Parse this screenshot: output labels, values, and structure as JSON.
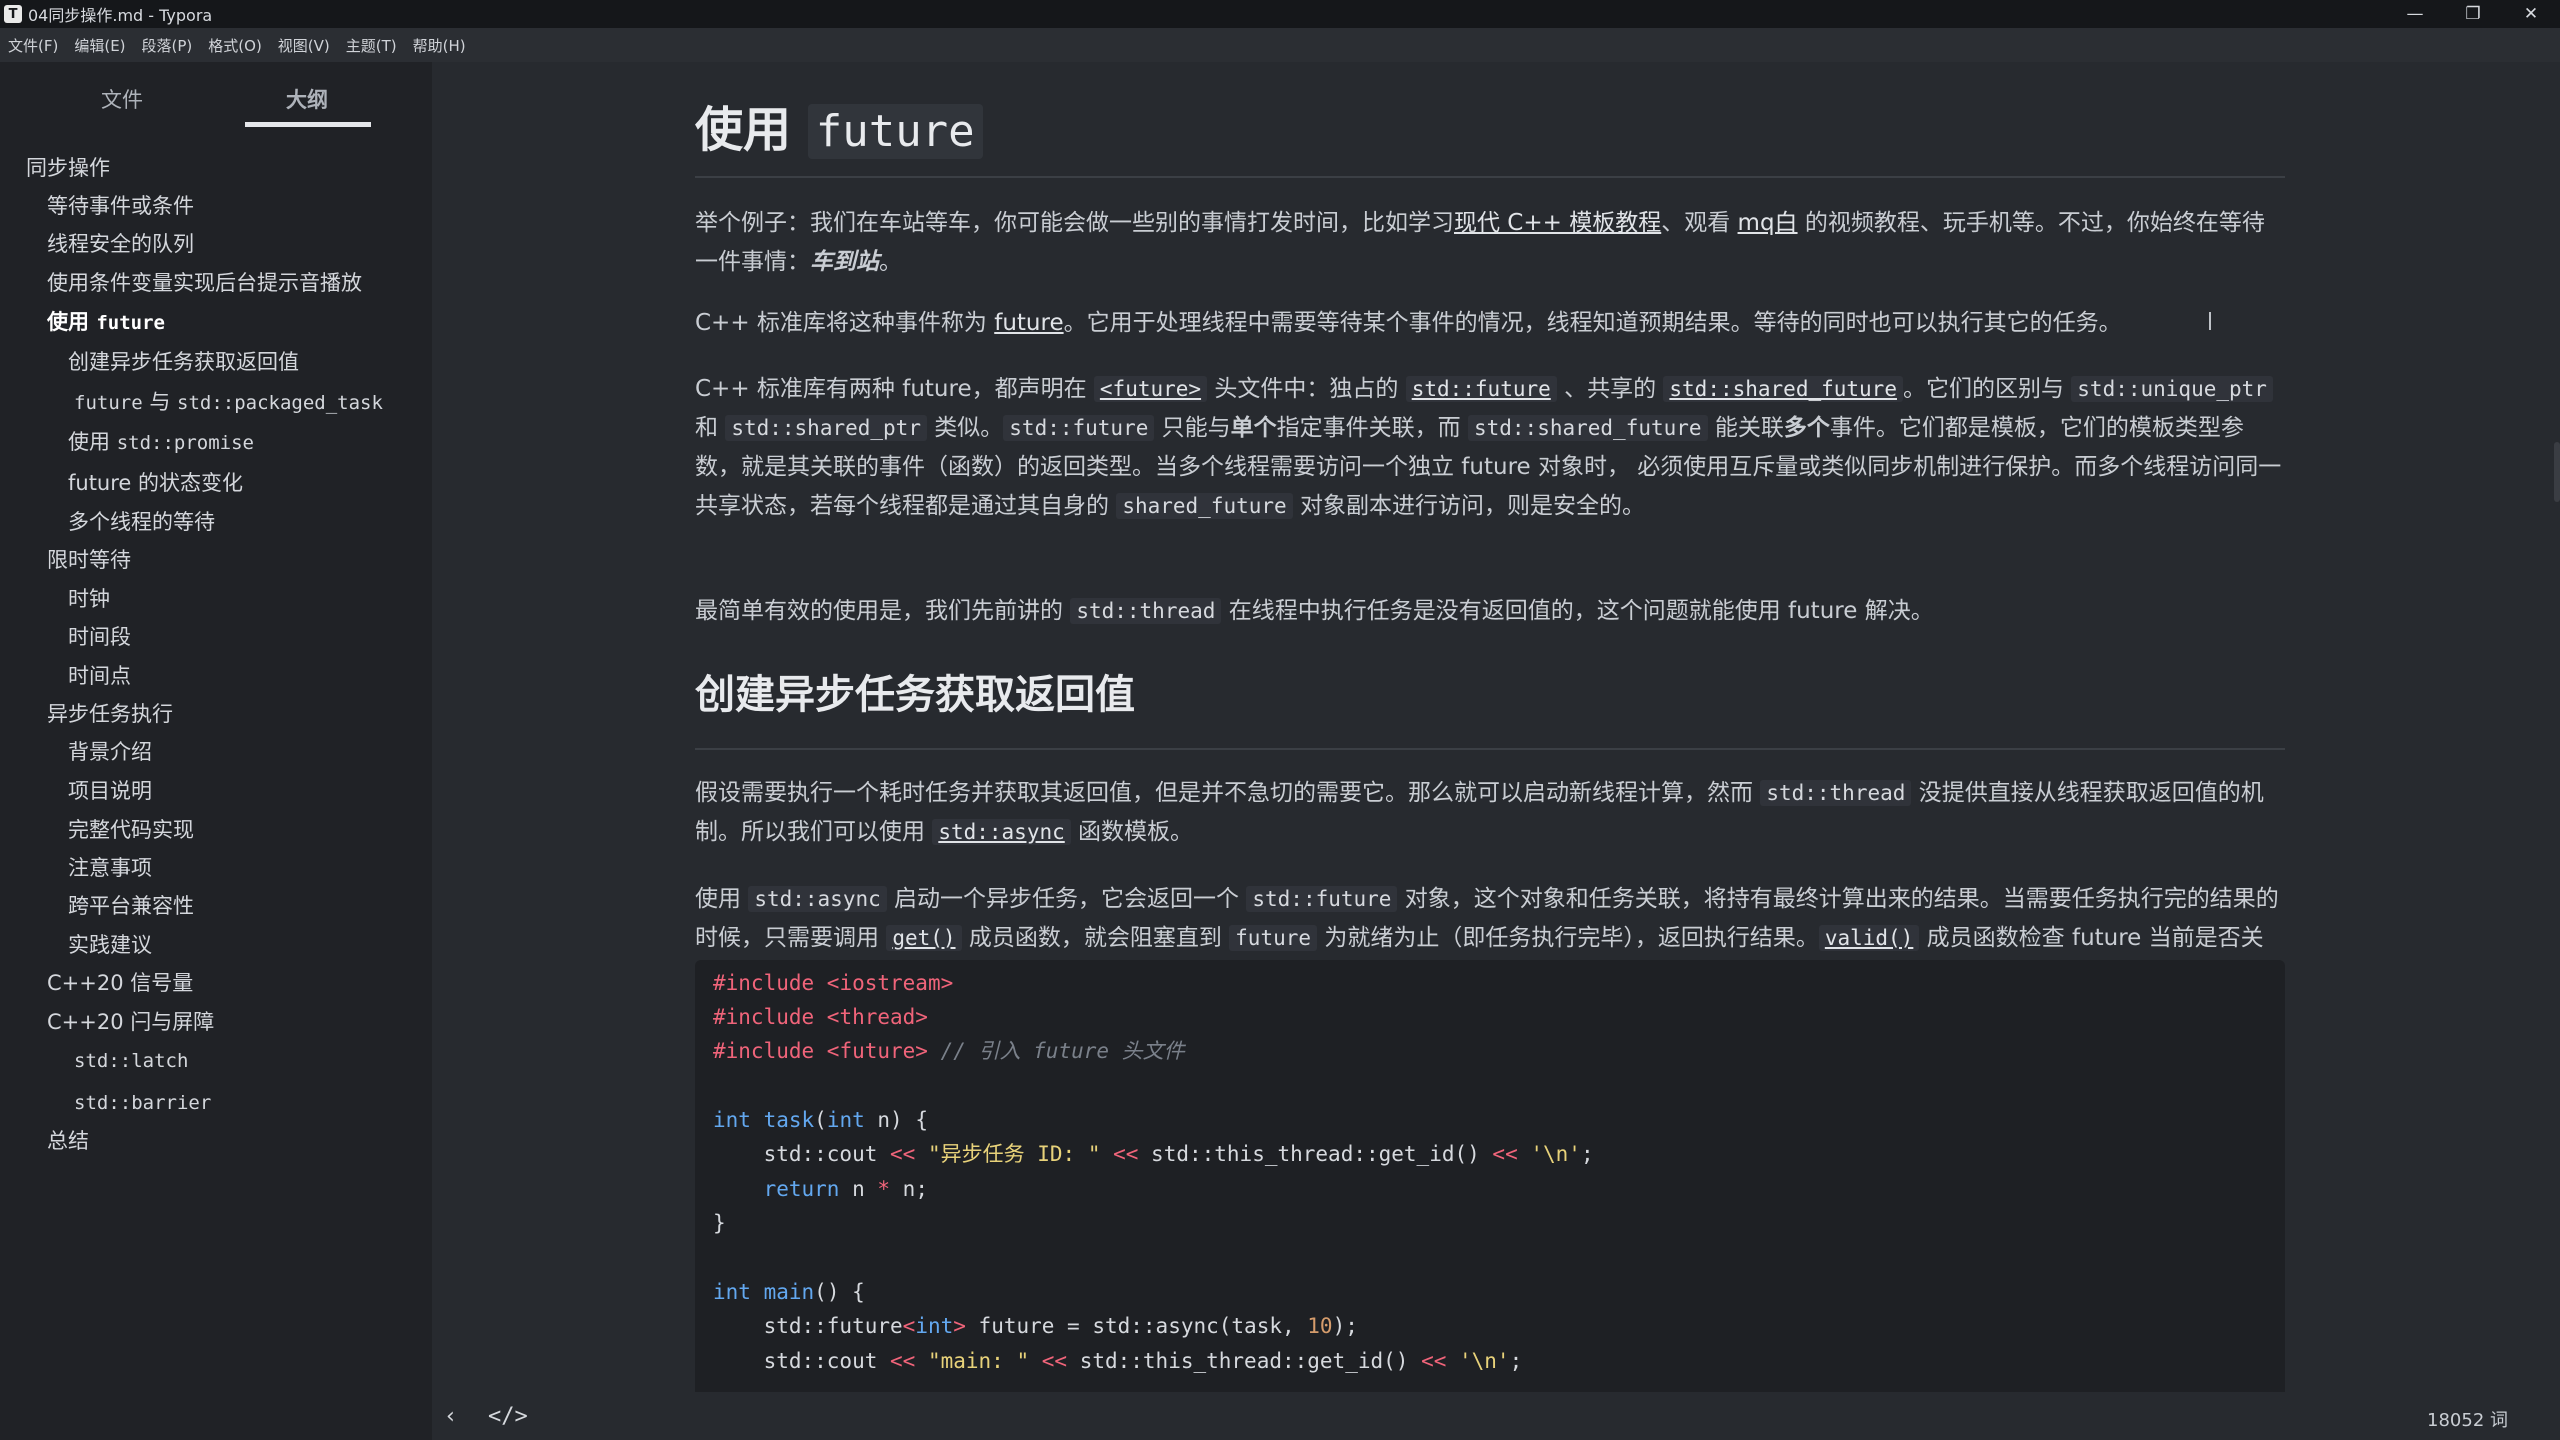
{
  "window": {
    "title": "04同步操作.md - Typora",
    "app_icon": "T",
    "controls": [
      "—",
      "❐",
      "✕"
    ]
  },
  "menu": [
    "文件(F)",
    "编辑(E)",
    "段落(P)",
    "格式(O)",
    "视图(V)",
    "主题(T)",
    "帮助(H)"
  ],
  "sidebar": {
    "tabs": [
      "文件",
      "大纲"
    ],
    "outline": [
      {
        "text": "同步操作"
      },
      {
        "text": "等待事件或条件"
      },
      {
        "text": "线程安全的队列"
      },
      {
        "text": "使用条件变量实现后台提示音播放"
      },
      {
        "text_pre": "使用 ",
        "code": "future"
      },
      {
        "text": "创建异步任务获取返回值"
      },
      {
        "code": "future",
        "text_mid": " 与 ",
        "code2": "std::packaged_task"
      },
      {
        "text_pre": "使用 ",
        "code": "std::promise"
      },
      {
        "text": "future 的状态变化"
      },
      {
        "text": "多个线程的等待"
      },
      {
        "text": "限时等待"
      },
      {
        "text": "时钟"
      },
      {
        "text": "时间段"
      },
      {
        "text": "时间点"
      },
      {
        "text": "异步任务执行"
      },
      {
        "text": "背景介绍"
      },
      {
        "text": "项目说明"
      },
      {
        "text": "完整代码实现"
      },
      {
        "text": "注意事项"
      },
      {
        "text": "跨平台兼容性"
      },
      {
        "text": "实践建议"
      },
      {
        "text": "C++20 信号量"
      },
      {
        "text": "C++20 闩与屏障"
      },
      {
        "code": "std::latch"
      },
      {
        "code": "std::barrier"
      },
      {
        "text": "总结"
      }
    ]
  },
  "doc": {
    "h1_text": "使用 ",
    "h1_code": "future",
    "p1": {
      "a": "举个例子：我们在车站等车，你可能会做一些别的事情打发时间，比如学习",
      "link1": "现代 C++ 模板教程",
      "b": "、观看 ",
      "link2": "mq白",
      "c": " 的视频教程、玩手机等。不过，你始终在等待一件事情：",
      "em": "车到站",
      "d": "。"
    },
    "p2": {
      "a": "C++ 标准库将这种事件称为 ",
      "link": "future",
      "b": "。它用于处理线程中需要等待某个事件的情况，线程知道预期结果。等待的同时也可以执行其它的任务。"
    },
    "p3": {
      "a": "C++ 标准库有两种 future，都声明在 ",
      "l1": "<future>",
      "b": " 头文件中：独占的 ",
      "l2": "std::future",
      "c": " 、共享的 ",
      "l3": "std::shared_future",
      "d": "。它们的区别与 ",
      "c1": "std::unique_ptr",
      "e": " 和 ",
      "c2": "std::shared_ptr",
      "f": " 类似。",
      "c3": "std::future",
      "g": " 只能与",
      "s1": "单个",
      "h": "指定事件关联，而 ",
      "c4": "std::shared_future",
      "i": " 能关联",
      "s2": "多个",
      "j": "事件。它们都是模板，它们的模板类型参数，就是其关联的事件（函数）的返回类型。当多个线程需要访问一个独立 future 对象时， 必须使用互斥量或类似同步机制进行保护。而多个线程访问同一共享状态，若每个线程都是通过其自身的 ",
      "c5": "shared_future",
      "k": " 对象副本进行访问，则是安全的。"
    },
    "p4": {
      "a": "最简单有效的使用是，我们先前讲的 ",
      "c1": "std::thread",
      "b": " 在线程中执行任务是没有返回值的，这个问题就能使用 future 解决。"
    },
    "h2": "创建异步任务获取返回值",
    "p5": {
      "a": "假设需要执行一个耗时任务并获取其返回值，但是并不急切的需要它。那么就可以启动新线程计算，然而 ",
      "c1": "std::thread",
      "b": " 没提供直接从线程获取返回值的机制。所以我们可以使用 ",
      "l1": "std::async",
      "c": " 函数模板。"
    },
    "p6": {
      "a": "使用 ",
      "c1": "std::async",
      "b": " 启动一个异步任务，它会返回一个 ",
      "c2": "std::future",
      "c": " 对象，这个对象和任务关联，将持有最终计算出来的结果。当需要任务执行完的结果的时候，只需要调用 ",
      "l1": "get()",
      "d": " 成员函数，就会阻塞直到 ",
      "c3": "future",
      "e": " 为就绪为止（即任务执行完毕），返回执行结果。",
      "l2": "valid()",
      "f": " 成员函数检查 future 当前是否关联共享状态，即是否当前关联任务。还未关联，或者任务已经执行完（调用了 get()、set()），都会返回 ",
      "c4": "false",
      "g": "。"
    },
    "code": {
      "l1_a": "#include ",
      "l1_b": "<iostream>",
      "l2_a": "#include ",
      "l2_b": "<thread>",
      "l3_a": "#include ",
      "l3_b": "<future>",
      "l3_c": " // 引入 future 头文件",
      "l5_a": "int",
      "l5_b": " ",
      "l5_c": "task",
      "l5_d": "(",
      "l5_e": "int",
      "l5_f": " n) {",
      "l6_a": "    std::cout ",
      "l6_b": "<<",
      "l6_c": " \"异步任务 ID: \" ",
      "l6_d": "<<",
      "l6_e": " std::this_thread::get_id() ",
      "l6_f": "<<",
      "l6_g": " '\\n'",
      "l6_h": ";",
      "l7_a": "    ",
      "l7_b": "return",
      "l7_c": " n ",
      "l7_d": "*",
      "l7_e": " n;",
      "l8": "}",
      "l10_a": "int",
      "l10_b": " ",
      "l10_c": "main",
      "l10_d": "() {",
      "l11_a": "    std::future",
      "l11_b": "<",
      "l11_c": "int",
      "l11_d": ">",
      "l11_e": " future = std::async(task, ",
      "l11_f": "10",
      "l11_g": ");",
      "l12_a": "    std::cout ",
      "l12_b": "<<",
      "l12_c": " \"main: \" ",
      "l12_d": "<<",
      "l12_e": " std::this_thread::get_id() ",
      "l12_f": "<<",
      "l12_g": " '\\n'",
      "l12_h": ";"
    }
  },
  "status": {
    "back_icon": "‹",
    "source_icon": "</>",
    "word_count": "18052 词"
  },
  "colors": {
    "background": "#272a2f",
    "sidebar": "#202226",
    "code_bg": "#1e2024",
    "keyword_red": "#f0647a",
    "keyword_blue": "#63a8f0",
    "string_yellow": "#e8d27a"
  }
}
